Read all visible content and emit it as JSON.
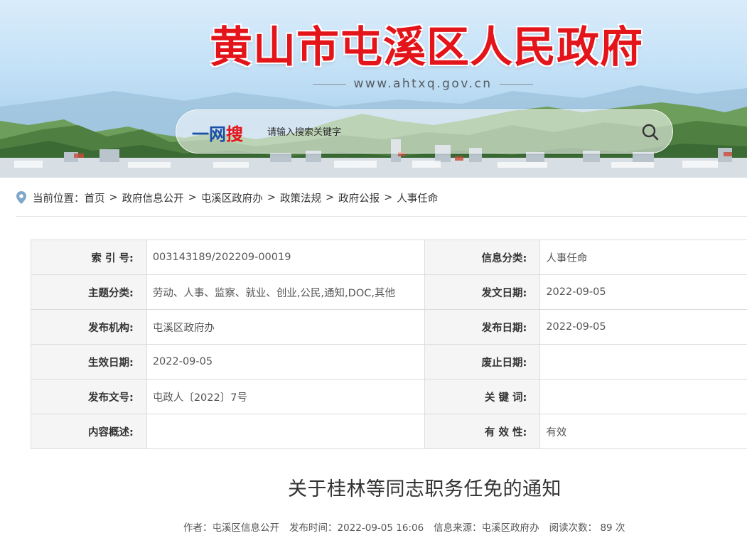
{
  "header": {
    "site_title": "黄山市屯溪区人民政府",
    "site_url": "www.ahtxq.gov.cn"
  },
  "search": {
    "logo_part1": "一网",
    "logo_part2": "搜",
    "placeholder": "请输入搜索关键字",
    "button_icon": "search-icon"
  },
  "breadcrumb": {
    "prefix": "当前位置：",
    "items": [
      "首页",
      "政府信息公开",
      "屯溪区政府办",
      "政策法规",
      "政府公报",
      "人事任命"
    ],
    "separator": ">"
  },
  "info": {
    "rows": [
      {
        "l1": "索 引 号:",
        "v1": "003143189/202209-00019",
        "l2": "信息分类:",
        "v2": "人事任命"
      },
      {
        "l1": "主题分类:",
        "v1": "劳动、人事、监察、就业、创业,公民,通知,DOC,其他",
        "l2": "发文日期:",
        "v2": "2022-09-05"
      },
      {
        "l1": "发布机构:",
        "v1": "屯溪区政府办",
        "l2": "发布日期:",
        "v2": "2022-09-05"
      },
      {
        "l1": "生效日期:",
        "v1": "2022-09-05",
        "l2": "废止日期:",
        "v2": ""
      },
      {
        "l1": "发布文号:",
        "v1": "屯政人〔2022〕7号",
        "l2": "关 键 词:",
        "v2": ""
      },
      {
        "l1": "内容概述:",
        "v1": "",
        "l2": "有 效 性:",
        "v2": "有效"
      }
    ]
  },
  "article": {
    "title": "关于桂林等同志职务任免的通知",
    "author_label": "作者：",
    "author": "屯溪区信息公开",
    "time_label": "发布时间：",
    "time": "2022-09-05 16:06",
    "source_label": "信息来源：",
    "source": "屯溪区政府办",
    "reads_label": "阅读次数：",
    "reads": "89",
    "reads_unit": "次"
  },
  "colors": {
    "title_red": "#e4141b",
    "logo_blue": "#1a4fa8",
    "label_bg": "#f5f5f5",
    "border": "#dcdcdc"
  }
}
